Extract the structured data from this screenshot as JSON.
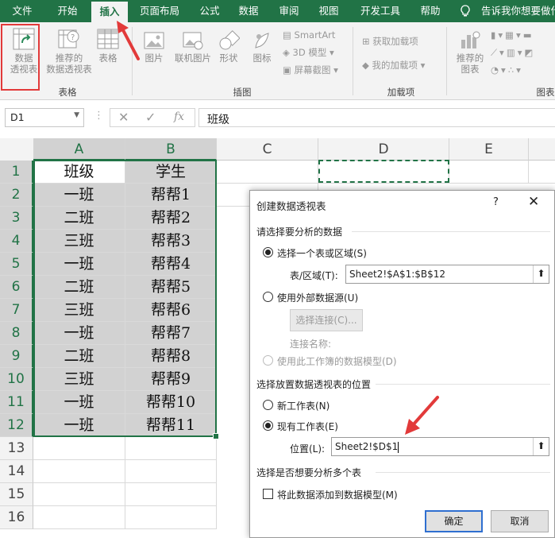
{
  "tabs": [
    "文件",
    "开始",
    "插入",
    "页面布局",
    "公式",
    "数据",
    "审阅",
    "视图",
    "开发工具",
    "帮助",
    "告诉我你想要做什"
  ],
  "ribbon": {
    "pivot_table": "数据\n透视表",
    "recommended_pivot": "推荐的\n数据透视表",
    "table": "表格",
    "group_tables": "表格",
    "pictures": "图片",
    "online_pictures": "联机图片",
    "shapes": "形状",
    "icons": "图标",
    "smartart": "SmartArt",
    "model3d": "3D 模型",
    "screenshot": "屏幕截图",
    "group_illustrations": "插图",
    "get_addins": "获取加载项",
    "my_addins": "我的加载项",
    "group_addins": "加载项",
    "recommended_charts": "推荐的\n图表",
    "group_charts": "图表"
  },
  "formula_bar": {
    "name_box": "D1",
    "formula": "班级",
    "fx": "fx"
  },
  "columns": [
    "A",
    "B",
    "C",
    "D",
    "E"
  ],
  "rows": [
    "1",
    "2",
    "3",
    "4",
    "5",
    "6",
    "7",
    "8",
    "9",
    "10",
    "11",
    "12",
    "13",
    "14",
    "15",
    "16"
  ],
  "data": {
    "col_a": [
      "班级",
      "一班",
      "二班",
      "三班",
      "一班",
      "二班",
      "三班",
      "一班",
      "二班",
      "三班",
      "一班",
      "一班"
    ],
    "col_b": [
      "学生",
      "帮帮1",
      "帮帮2",
      "帮帮3",
      "帮帮4",
      "帮帮5",
      "帮帮6",
      "帮帮7",
      "帮帮8",
      "帮帮9",
      "帮帮10",
      "帮帮11"
    ]
  },
  "dialog": {
    "title": "创建数据透视表",
    "help": "?",
    "close": "✕",
    "section1": "请选择要分析的数据",
    "opt_range": "选择一个表或区域(S)",
    "range_label": "表/区域(T):",
    "range_value": "Sheet2!$A$1:$B$12",
    "opt_external": "使用外部数据源(U)",
    "choose_conn": "选择连接(C)...",
    "conn_name": "连接名称:",
    "opt_model": "使用此工作簿的数据模型(D)",
    "section2": "选择放置数据透视表的位置",
    "opt_new": "新工作表(N)",
    "opt_existing": "现有工作表(E)",
    "location_label": "位置(L):",
    "location_value": "Sheet2!$D$1",
    "section3": "选择是否想要分析多个表",
    "add_model": "将此数据添加到数据模型(M)",
    "ok": "确定",
    "cancel": "取消"
  },
  "colors": {
    "excel_green": "#217346",
    "annotation_red": "#e23a3a"
  }
}
